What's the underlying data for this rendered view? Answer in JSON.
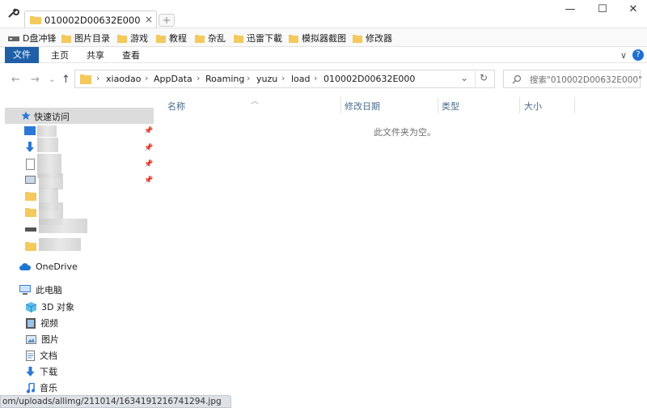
{
  "window": {
    "tab_title": "010002D00632E000",
    "tab_close": "×",
    "minimize": "—",
    "maximize": "☐",
    "close": "✕"
  },
  "bookmarks": [
    {
      "label": "D盘冲锋",
      "icon": "drive-icon"
    },
    {
      "label": "图片目录",
      "icon": "folder-icon"
    },
    {
      "label": "游戏",
      "icon": "folder-icon"
    },
    {
      "label": "教程",
      "icon": "folder-icon"
    },
    {
      "label": "杂乱",
      "icon": "folder-icon"
    },
    {
      "label": "迅雷下載",
      "icon": "folder-icon"
    },
    {
      "label": "模拟器截图",
      "icon": "folder-icon"
    },
    {
      "label": "修改器",
      "icon": "folder-icon"
    }
  ],
  "ribbon": {
    "tabs": [
      "文件",
      "主页",
      "共享",
      "查看"
    ],
    "expand": "∨",
    "help": "?"
  },
  "address": {
    "crumbs": [
      "xiaodao",
      "AppData",
      "Roaming",
      "yuzu",
      "load",
      "010002D00632E000"
    ],
    "search_placeholder": "搜索\"010002D00632E000\""
  },
  "navpane": {
    "quick_access": "快速访问",
    "onedrive": "OneDrive",
    "this_pc": "此电脑",
    "pc_items": [
      "3D 对象",
      "视频",
      "图片",
      "文档",
      "下载",
      "音乐"
    ]
  },
  "content": {
    "columns": [
      "名称",
      "修改日期",
      "类型",
      "大小"
    ],
    "empty_message": "此文件夹为空。"
  },
  "status_url": "om/uploads/allimg/211014/1634191216741294.jpg",
  "colors": {
    "accent": "#1f5fa8",
    "folder": "#f4c95d",
    "selection": "#dcdcdc"
  }
}
